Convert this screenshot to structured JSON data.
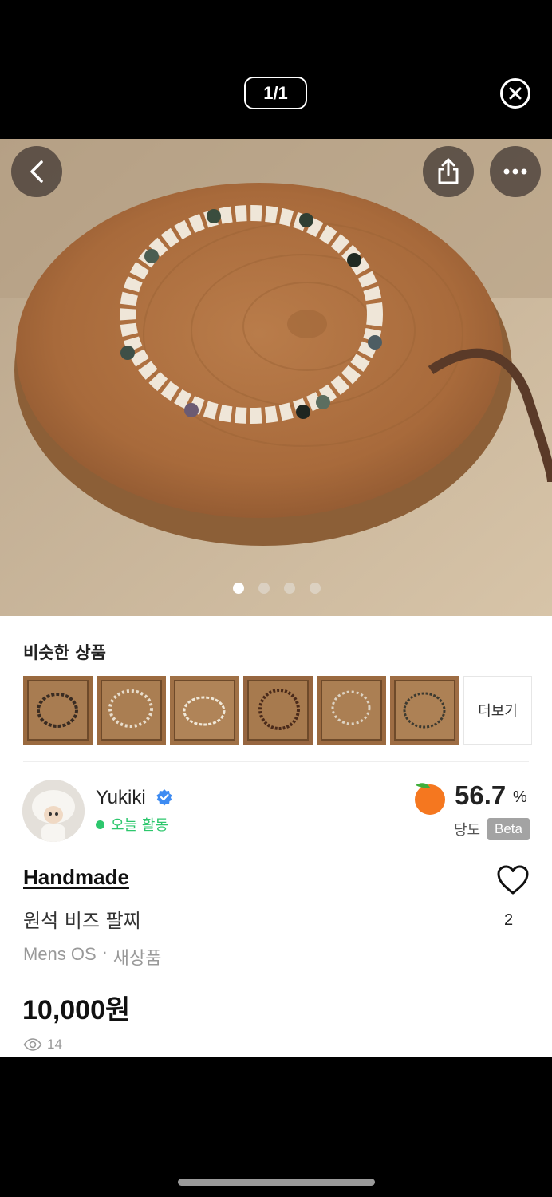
{
  "viewer": {
    "counter": "1/1"
  },
  "gallery": {
    "total_images": 4,
    "active_index": 0
  },
  "similar": {
    "title": "비슷한 상품",
    "thumbnails": [
      "similar-bracelet-1",
      "similar-bracelet-2",
      "similar-bracelet-3",
      "similar-bracelet-4",
      "similar-bracelet-5",
      "similar-bracelet-6"
    ],
    "more_label": "더보기"
  },
  "seller": {
    "name": "Yukiki",
    "activity": "오늘 활동",
    "score": "56.7",
    "score_unit": "%",
    "score_label": "당도",
    "beta_label": "Beta"
  },
  "product": {
    "brand": "Handmade",
    "name": "원석 비즈 팔찌",
    "size": "Mens OS",
    "separator": "·",
    "condition": "새상품",
    "price": "10,000원",
    "likes": "2",
    "views": "14"
  },
  "colors": {
    "accent_green": "#2dc76d",
    "peach": "#f5771f",
    "verified_blue": "#3d8bf2"
  },
  "icons": [
    "close-icon",
    "back-icon",
    "share-icon",
    "more-icon",
    "verified-icon",
    "peach-icon",
    "heart-icon",
    "eye-icon"
  ]
}
